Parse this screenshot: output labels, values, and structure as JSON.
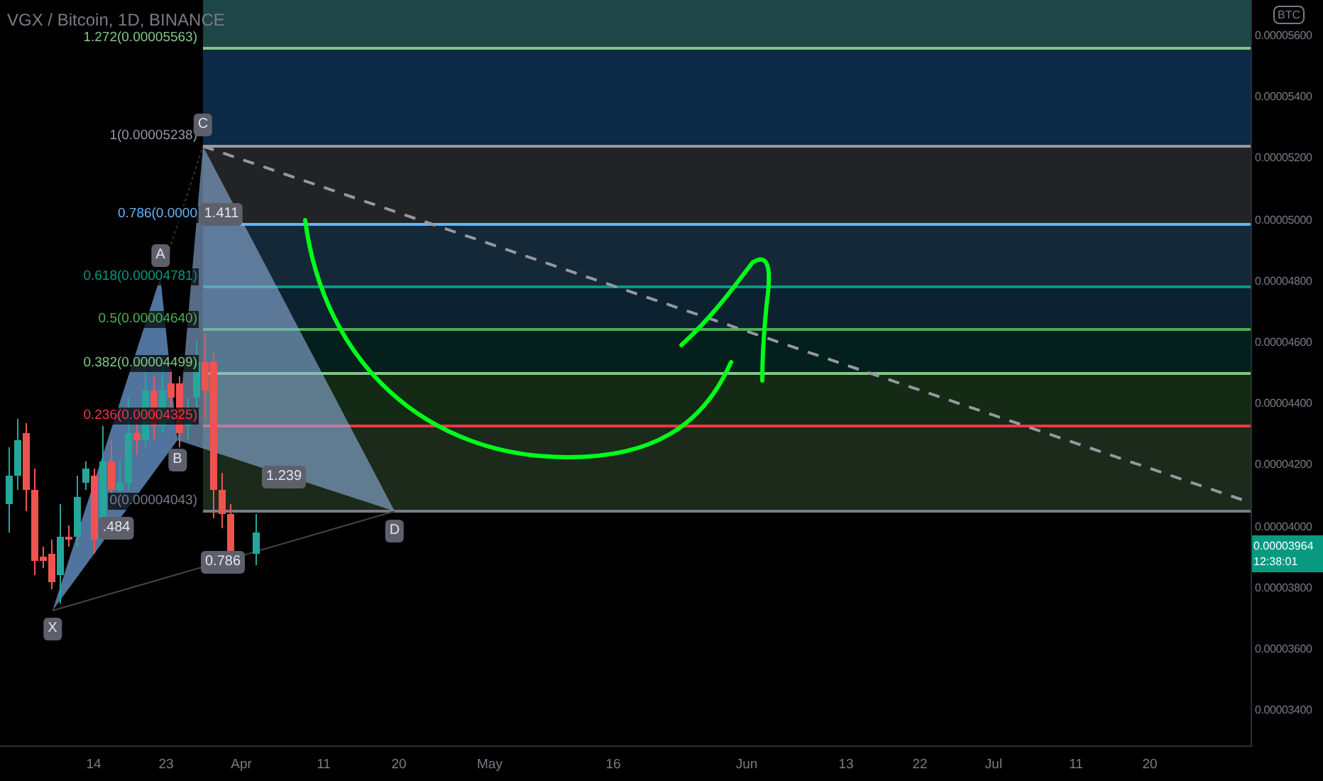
{
  "chart": {
    "title": "VGX / Bitcoin, 1D, BINANCE",
    "fib_levels": [
      {
        "label": "1.272(0.00005563)",
        "color": "#81c784"
      },
      {
        "label": "1(0.00005238)",
        "color": "#9598a1"
      },
      {
        "label": "0.786(0.0000",
        "color": "#64b5f6"
      },
      {
        "label": "0.618(0.00004781)",
        "color": "#089981"
      },
      {
        "label": "0.5(0.00004640)",
        "color": "#4caf50"
      },
      {
        "label": "0.382(0.00004499)",
        "color": "#81c784"
      },
      {
        "label": "0.236(0.00004325)",
        "color": "#f23645"
      },
      {
        "label": "0(0.00004043)",
        "color": "#787b86"
      }
    ],
    "pattern_points": [
      "X",
      "A",
      "B",
      "C",
      "D"
    ],
    "ratios": [
      "1.411",
      ".484",
      "1.239",
      "0.786"
    ]
  },
  "price_axis": {
    "currency": "BTC",
    "labels": [
      "0.00005600",
      "0.00005400",
      "0.00005200",
      "0.00005000",
      "0.00004800",
      "0.00004600",
      "0.00004400",
      "0.00004200",
      "0.00004000",
      "0.00003800",
      "0.00003600",
      "0.00003400"
    ],
    "last_price": "0.00003964",
    "countdown": "12:38:01"
  },
  "time_axis": {
    "labels": [
      "14",
      "23",
      "Apr",
      "11",
      "20",
      "May",
      "16",
      "Jun",
      "13",
      "22",
      "Jul",
      "11",
      "20"
    ]
  }
}
